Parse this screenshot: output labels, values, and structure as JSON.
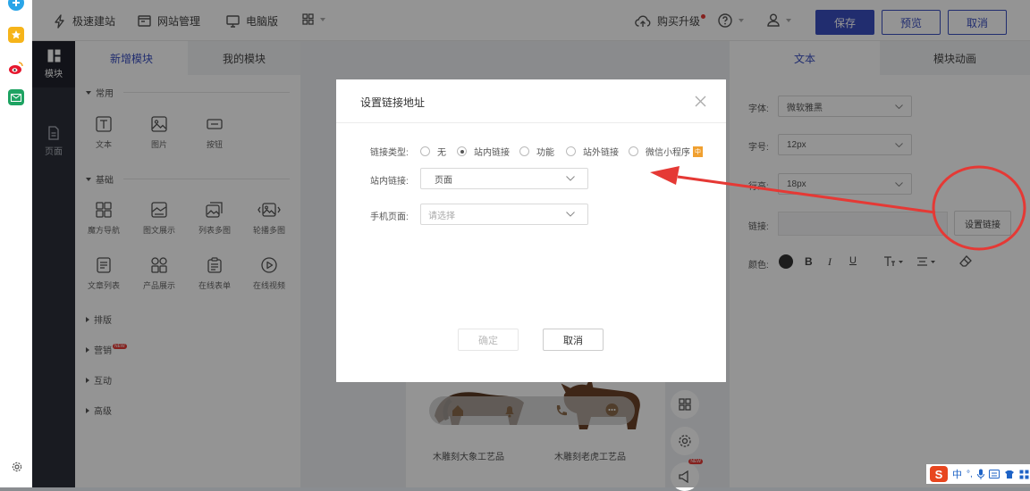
{
  "topbar": {
    "quick_build": "极速建站",
    "site_manage": "网站管理",
    "pc_version": "电脑版",
    "buy_upgrade": "购买升级",
    "save": "保存",
    "preview": "预览",
    "cancel": "取消"
  },
  "darkbar": {
    "module": "模块",
    "page": "页面"
  },
  "panel": {
    "tab_new": "新增模块",
    "tab_mine": "我的模块",
    "sec_common": "常用",
    "sec_basic": "基础",
    "tiles_common": [
      "文本",
      "图片",
      "按钮"
    ],
    "tiles_basic_1": [
      "魔方导航",
      "图文展示",
      "列表多图",
      "轮播多图"
    ],
    "tiles_basic_2": [
      "文章列表",
      "产品展示",
      "在线表单",
      "在线视频"
    ],
    "sec_layout": "排版",
    "sec_marketing": "营销",
    "new_badge": "NEW",
    "sec_interact": "互动",
    "sec_advanced": "高级"
  },
  "canvas": {
    "product_1": "木雕刻大象工艺品",
    "product_2": "木雕刻老虎工艺品",
    "new_badge": "NEW"
  },
  "rpanel": {
    "tab_text": "文本",
    "tab_anim": "模块动画",
    "font_label": "字体:",
    "font_value": "微软雅黑",
    "size_label": "字号:",
    "size_value": "12px",
    "line_label": "行高:",
    "line_value": "18px",
    "link_label": "链接:",
    "set_link": "设置链接",
    "color_label": "颜色:",
    "bold": "B",
    "italic": "I",
    "underline": "U"
  },
  "dialog": {
    "title": "设置链接地址",
    "type_label": "链接类型:",
    "options": [
      "无",
      "站内链接",
      "功能",
      "站外链接",
      "微信小程序"
    ],
    "mini_badge": "中",
    "inner_label": "站内链接:",
    "inner_value": "页面",
    "mobile_label": "手机页面:",
    "mobile_placeholder": "请选择",
    "confirm": "确定",
    "cancel": "取消"
  },
  "colors": {
    "primary": "#3a4fc0",
    "dark_sidebar": "#2b2f3a",
    "annotation_red": "#e53935"
  }
}
